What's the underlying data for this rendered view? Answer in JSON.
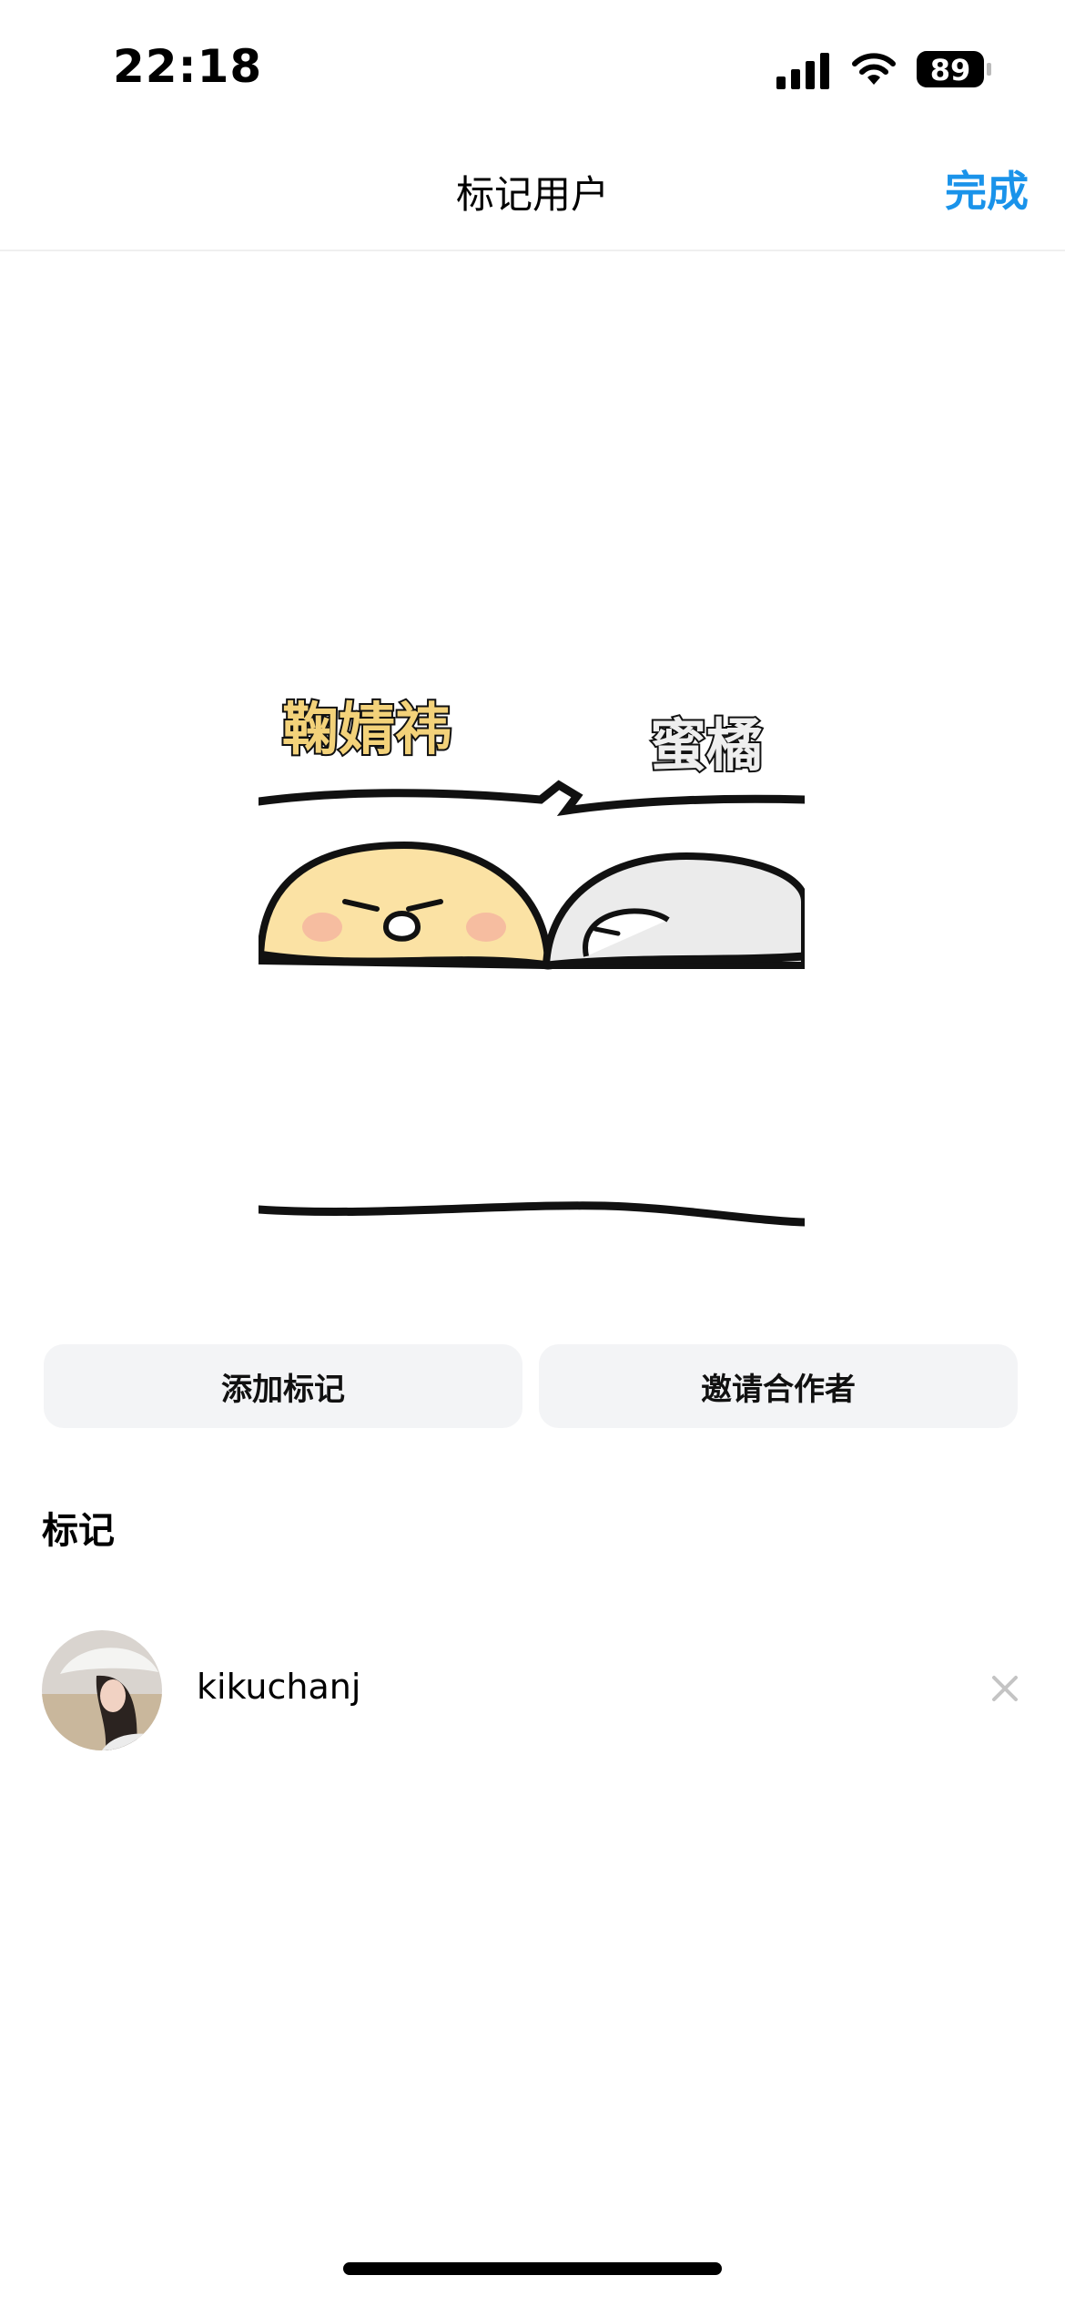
{
  "status_bar": {
    "time": "22:18",
    "battery": "89"
  },
  "nav": {
    "title": "标记用户",
    "done_label": "完成"
  },
  "photo": {
    "caption_left": "鞠婧祎",
    "caption_right": "蜜橘"
  },
  "actions": {
    "add_tag_label": "添加标记",
    "invite_collaborator_label": "邀请合作者"
  },
  "tags_section": {
    "title": "标记",
    "users": [
      {
        "username": "kikuchanj"
      }
    ]
  },
  "colors": {
    "accent": "#1a93ea",
    "button_bg": "#f3f4f6"
  },
  "icons": {
    "signal": "cellular-signal-icon",
    "wifi": "wifi-icon",
    "battery": "battery-icon",
    "remove": "close-icon"
  }
}
